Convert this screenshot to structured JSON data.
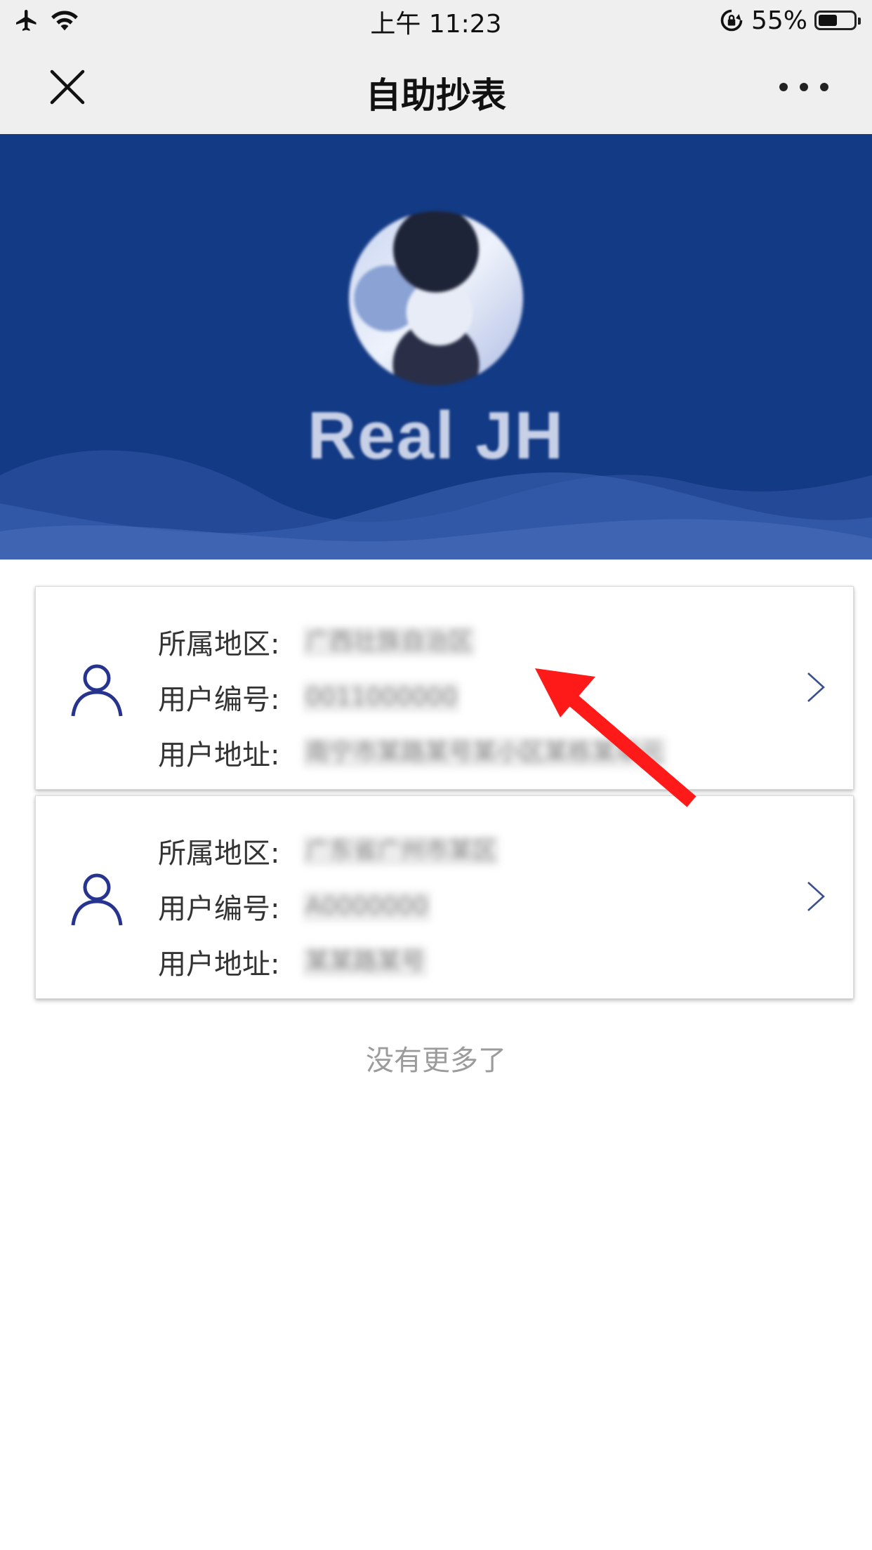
{
  "status_bar": {
    "time": "上午 11:23",
    "battery_percent": "55%",
    "battery_level": 0.55,
    "icons": [
      "airplane-icon",
      "wifi-icon",
      "rotation-lock-icon",
      "battery-icon"
    ]
  },
  "navbar": {
    "title": "自助抄表",
    "close_icon": "close-icon",
    "more_icon": "more-icon"
  },
  "header": {
    "username": "Real JH"
  },
  "accounts": [
    {
      "region_label": "所属地区:",
      "region_value": "广西壮族自治区",
      "id_label": "用户编号:",
      "id_value": "0011000000",
      "address_label": "用户地址:",
      "address_value": "南宁市某路某号某小区某栋某单元"
    },
    {
      "region_label": "所属地区:",
      "region_value": "广东省广州市某区",
      "id_label": "用户编号:",
      "id_value": "A0000000",
      "address_label": "用户地址:",
      "address_value": "某某路某号"
    }
  ],
  "footer": {
    "text": "没有更多了"
  },
  "colors": {
    "banner": "#133a85",
    "icon_blue": "#26348f",
    "annotation_red": "#ff1a1a"
  }
}
